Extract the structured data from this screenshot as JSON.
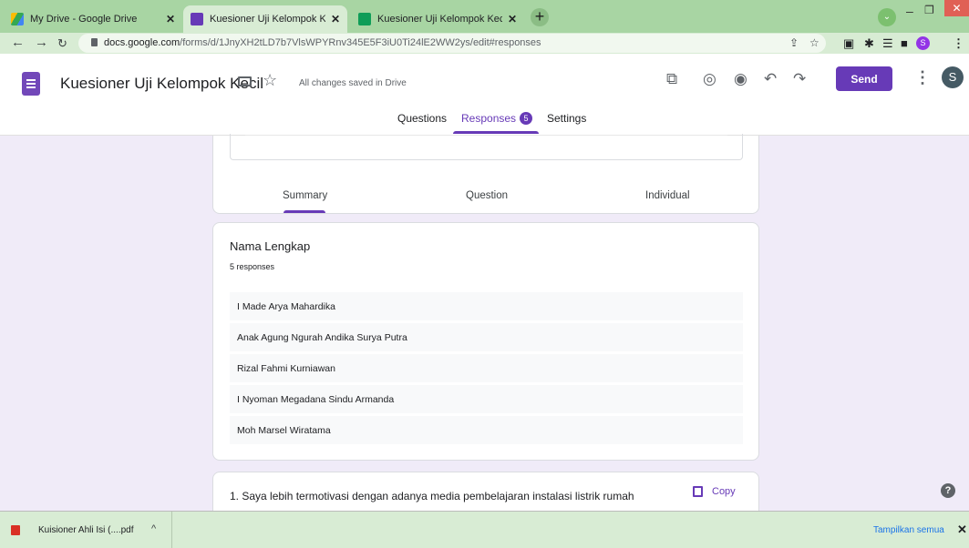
{
  "browser": {
    "tabs": [
      {
        "title": "My Drive - Google Drive",
        "active": false,
        "icon": "google-drive-icon"
      },
      {
        "title": "Kuesioner Uji Kelompok Kecil - Go",
        "active": true,
        "icon": "google-forms-icon"
      },
      {
        "title": "Kuesioner Uji Kelompok Kecil (Re",
        "active": false,
        "icon": "google-sheets-icon"
      }
    ],
    "new_tab_label": "+",
    "url_host": "docs.google.com",
    "url_path": "/forms/d/1JnyXH2tLD7b7VlsWPYRnv345E5F3iU0Ti24lE2WW2ys/edit#responses",
    "profile_initial": "S"
  },
  "forms_header": {
    "title": "Kuesioner Uji Kelompok Kecil",
    "save_status": "All changes saved in Drive",
    "send_label": "Send",
    "avatar_initial": "S",
    "tabs": {
      "questions": "Questions",
      "responses": "Responses",
      "responses_badge": "5",
      "settings": "Settings"
    }
  },
  "summary_tabs": {
    "summary": "Summary",
    "question": "Question",
    "individual": "Individual"
  },
  "response_card": {
    "question": "Nama Lengkap",
    "count": "5 responses",
    "answers": [
      "I Made Arya Mahardika",
      "Anak Agung Ngurah Andika Surya Putra",
      "Rizal Fahmi Kurniawan",
      "I Nyoman Megadana Sindu Armanda",
      "Moh Marsel Wiratama"
    ]
  },
  "next_card": {
    "question": "1. Saya lebih termotivasi dengan adanya media pembelajaran instalasi listrik rumah",
    "copy_label": "Copy"
  },
  "downloads": {
    "file_name": "Kuisioner Ahli Isi (....pdf",
    "show_all": "Tampilkan semua"
  },
  "colors": {
    "forms_purple": "#673ab7",
    "page_bg": "#f0ebf8",
    "chrome_green": "#a8d5a3"
  }
}
